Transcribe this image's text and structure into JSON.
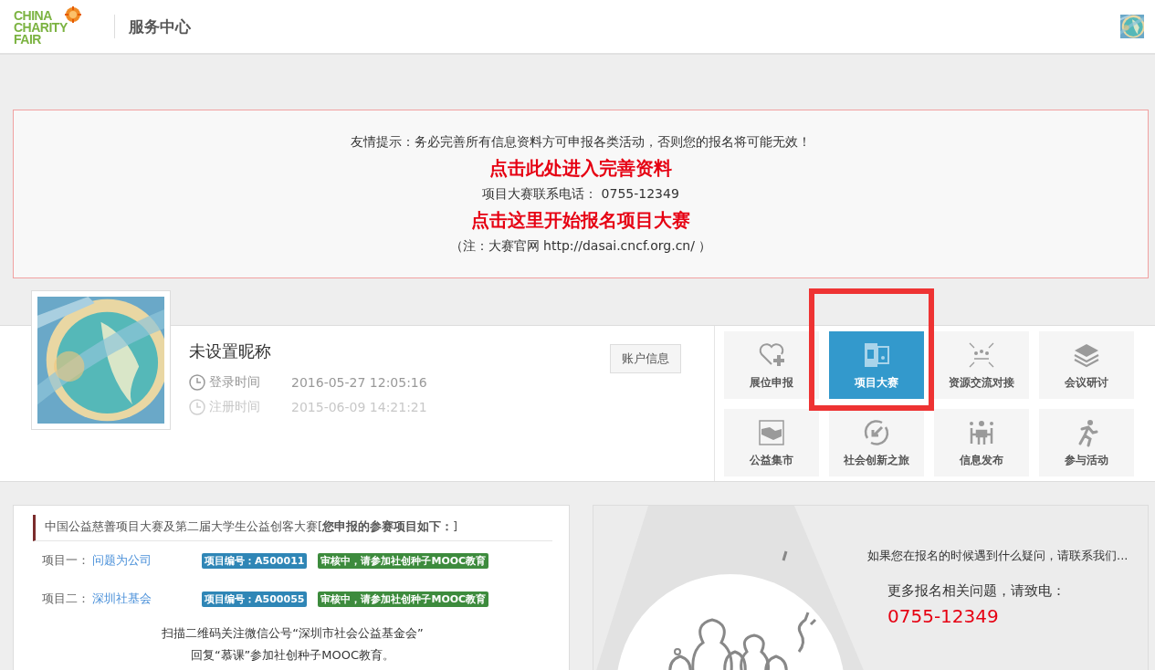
{
  "header": {
    "logo_lines": [
      "CHINA",
      "CHARITY",
      "FAIR"
    ],
    "title": "服务中心"
  },
  "notice": {
    "lines": [
      {
        "kind": "text",
        "text": "友情提示：务必完善所有信息资料方可申报各类活动，否则您的报名将可能无效！"
      },
      {
        "kind": "link",
        "text": "点击此处进入完善资料"
      },
      {
        "kind": "text",
        "text": "项目大赛联系电话： 0755-12349"
      },
      {
        "kind": "link",
        "text": "点击这里开始报名项目大赛"
      },
      {
        "kind": "text",
        "text": "（注：大赛官网 http://dasai.cncf.org.cn/ ）"
      }
    ]
  },
  "profile": {
    "nickname": "未设置昵称",
    "account_button": "账户信息",
    "times": [
      {
        "label": "登录时间",
        "value": "2016-05-27 12:05:16",
        "muted": false
      },
      {
        "label": "注册时间",
        "value": "2015-06-09 14:21:21",
        "muted": true
      }
    ]
  },
  "tiles": [
    {
      "kind": "heart",
      "label": "展位申报",
      "selected": false
    },
    {
      "kind": "slides",
      "label": "项目大赛",
      "selected": true
    },
    {
      "kind": "people",
      "label": "资源交流对接",
      "selected": false
    },
    {
      "kind": "layers",
      "label": "会议研讨",
      "selected": false
    },
    {
      "kind": "handshake",
      "label": "公益集市",
      "selected": false
    },
    {
      "kind": "cycle",
      "label": "社会创新之旅",
      "selected": false
    },
    {
      "kind": "meeting",
      "label": "信息发布",
      "selected": false
    },
    {
      "kind": "runner",
      "label": "参与活动",
      "selected": false
    }
  ],
  "projects_card": {
    "title": "中国公益慈善项目大赛及第二届大学生公益创客大赛[**您申报的参赛项目如下：**]",
    "projects": [
      {
        "label": "项目一：",
        "name": "问题为公司",
        "code": "项目编号：A500011",
        "status": "审核中，请参加社创种子MOOC教育"
      },
      {
        "label": "项目二：",
        "name": "深圳社基会",
        "code": "项目编号：A500055",
        "status": "审核中，请参加社创种子MOOC教育"
      }
    ],
    "notes": [
      "扫描二维码关注微信公号“深圳市社会公益基金会”",
      "回复“慕课”参加社创种子MOOC教育。"
    ]
  },
  "help_card": {
    "intro": "如果您在报名的时候遇到什么疑问，请联系我们...",
    "prompt": "更多报名相关问题，请致电：",
    "phone": "0755-12349"
  }
}
